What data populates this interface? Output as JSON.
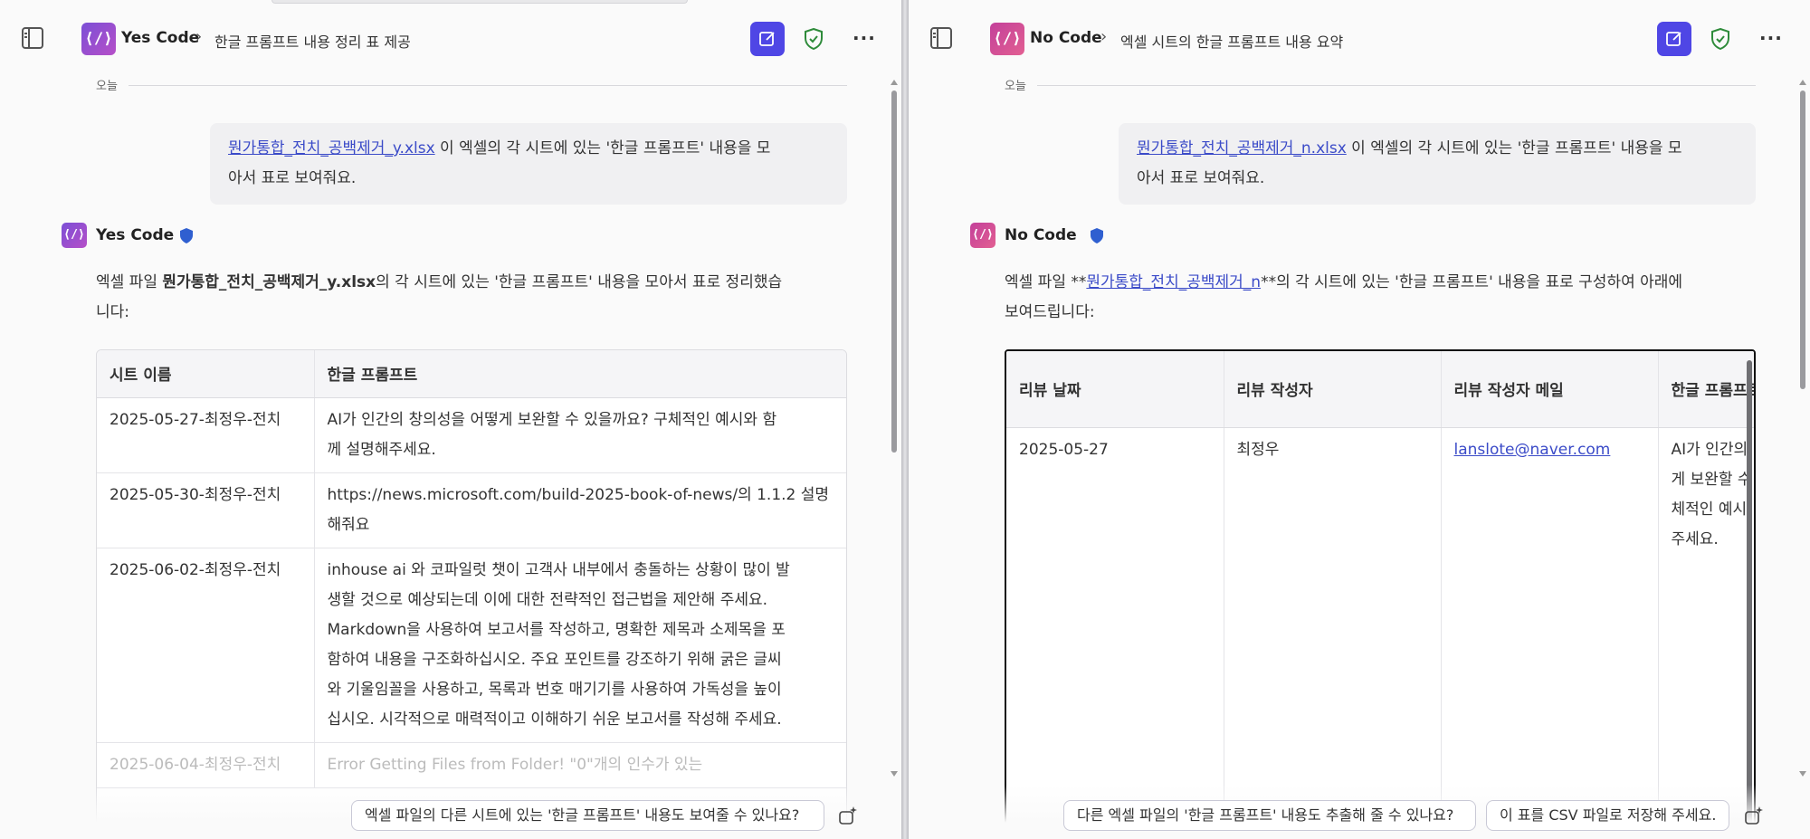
{
  "left": {
    "brand": "Yes Code",
    "breadcrumb_title": "한글 프롬프트 내용 정리 표 제공",
    "date_separator": "오늘",
    "user_message": {
      "file_link": "뭔가통합_전치_공백제거_y.xlsx",
      "line1_rest": " 이 엑셀의 각 시트에 있는 '한글 프롬프트' 내용을 모",
      "line2": "아서 표로 보여줘요."
    },
    "bot_name": "Yes Code",
    "reply": {
      "prefix": "엑셀 파일 ",
      "file_bold": "뭔가통합_전치_공백제거_y.xlsx",
      "line1_rest": "의 각 시트에 있는 '한글 프롬프트' 내용을 모아서 표로 정리했습",
      "line2": "니다:"
    },
    "table": {
      "headers": [
        "시트 이름",
        "한글 프롬프트"
      ],
      "rows": [
        {
          "sheet": "2025-05-27-최정우-전치",
          "lines": [
            "AI가 인간의 창의성을 어떻게 보완할 수 있을까요? 구체적인 예시와 함",
            "께 설명해주세요."
          ]
        },
        {
          "sheet": "2025-05-30-최정우-전치",
          "lines": [
            "https://news.microsoft.com/build-2025-book-of-news/의 1.1.2 설명",
            "해줘요"
          ]
        },
        {
          "sheet": "2025-06-02-최정우-전치",
          "lines": [
            "inhouse ai 와 코파일럿 챗이 고객사 내부에서 충돌하는 상황이 많이 발",
            "생할 것으로 예상되는데 이에 대한 전략적인 접근법을 제안해 주세요.",
            "Markdown을 사용하여 보고서를 작성하고, 명확한 제목과 소제목을 포",
            "함하여 내용을 구조화하십시오. 주요 포인트를 강조하기 위해 굵은 글씨",
            "와 기울임꼴을 사용하고, 목록과 번호 매기기를 사용하여 가독성을 높이",
            "십시오. 시각적으로 매력적이고 이해하기 쉬운 보고서를 작성해 주세요."
          ]
        },
        {
          "sheet": "2025-06-04-최정우-전치",
          "lines": [
            "Error Getting Files from Folder! \"0\"개의 인수가 있는"
          ]
        }
      ]
    },
    "suggestion": "엑셀 파일의 다른 시트에 있는 '한글 프롬프트' 내용도 보여줄 수 있나요?"
  },
  "right": {
    "brand": "No Code",
    "breadcrumb_title": "엑셀 시트의 한글 프롬프트 내용 요약",
    "date_separator": "오늘",
    "user_message": {
      "file_link": "뭔가통합_전치_공백제거_n.xlsx",
      "line1_rest": " 이 엑셀의 각 시트에 있는 '한글 프롬프트' 내용을 모",
      "line2": "아서 표로 보여줘요."
    },
    "bot_name": "No Code",
    "reply": {
      "prefix": "엑셀 파일 **",
      "file_link": "뭔가통합_전치_공백제거_n",
      "line1_rest": "**의 각 시트에 있는 '한글 프롬프트' 내용을 표로 구성하여 아래에",
      "line2": "보여드립니다:"
    },
    "table": {
      "headers": [
        "리뷰 날짜",
        "리뷰 작성자",
        "리뷰 작성자 메일",
        "한글 프롬프트"
      ],
      "row": {
        "date": "2025-05-27",
        "author": "최정우",
        "email": "lanslote@naver.com",
        "prompt_lines": [
          "AI가 인간의",
          "게 보완할 수",
          "체적인 예시",
          "주세요."
        ]
      }
    },
    "suggestions": [
      "다른 엑셀 파일의 '한글 프롬프트' 내용도 추출해 줄 수 있나요?",
      "이 표를 CSV 파일로 저장해 주세요."
    ]
  },
  "colors": {
    "accent": "#4f46e5",
    "link": "#3b4bc8",
    "shield_green": "#2e8b3a",
    "badge_blue": "#2f5fd0"
  }
}
